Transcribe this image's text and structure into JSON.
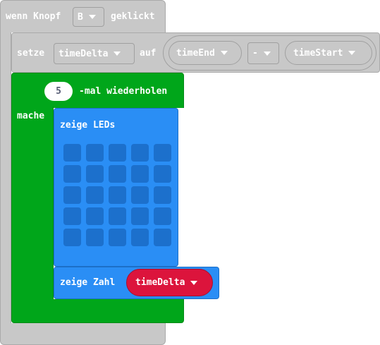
{
  "event_block": {
    "prefix": "wenn Knopf",
    "button_value": "B",
    "suffix": "geklickt"
  },
  "set_block": {
    "label": "setze",
    "variable": "timeDelta",
    "connector": "auf",
    "left_operand": "timeEnd",
    "operator": "-",
    "right_operand": "timeStart"
  },
  "repeat_block": {
    "count": "5",
    "label": "-mal wiederholen",
    "do_label": "mache"
  },
  "show_leds_block": {
    "label": "zeige LEDs",
    "led_rows": 5,
    "led_cols": 5
  },
  "show_number_block": {
    "label": "zeige Zahl",
    "variable": "timeDelta"
  },
  "colors": {
    "event": "#c8c8c8",
    "loop": "#00a61a",
    "basic": "#2a8ef5",
    "variable_reporter": "#dc143c"
  }
}
